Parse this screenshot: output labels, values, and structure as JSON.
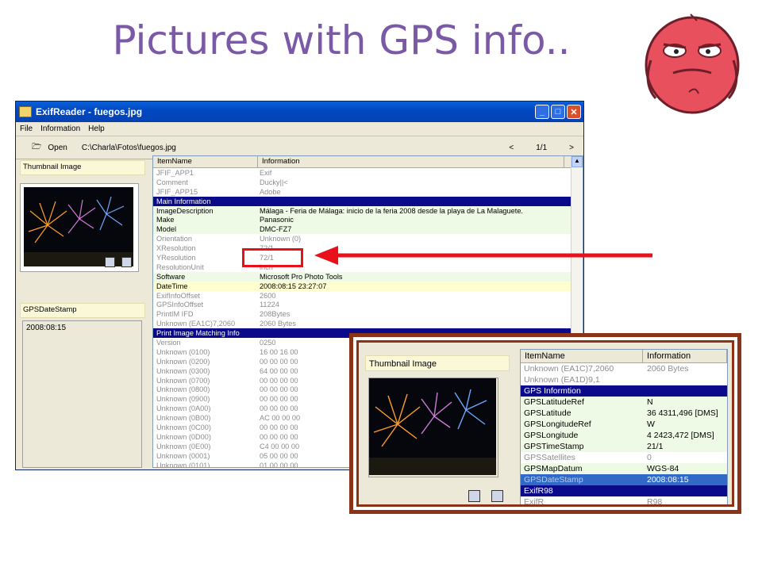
{
  "slide": {
    "title": "Pictures with GPS info.."
  },
  "window": {
    "title": "ExifReader - fuegos.jpg",
    "menu": [
      "File",
      "Information",
      "Help"
    ],
    "open_label": "Open",
    "path": "C:\\Charla\\Fotos\\fuegos.jpg",
    "pager": {
      "prev": "<",
      "page": "1/1",
      "next": ">"
    },
    "thumbnail_header": "Thumbnail Image",
    "gps_header": "GPSDateStamp",
    "gps_value": "2008:08:15",
    "columns": [
      "ItemName",
      "Information"
    ],
    "rows": [
      {
        "name": "JFIF_APP1",
        "value": "Exif",
        "style": "gray"
      },
      {
        "name": "Comment",
        "value": "Ducky||<",
        "style": "gray"
      },
      {
        "name": "JFIF_APP15",
        "value": "Adobe",
        "style": "gray"
      },
      {
        "name": "Main Information",
        "value": "",
        "style": "section"
      },
      {
        "name": "ImageDescription",
        "value": "Málaga - Feria de Málaga: inicio de la feria 2008 desde la playa de La Malaguete.",
        "style": "green"
      },
      {
        "name": "Make",
        "value": "Panasonic",
        "style": "green"
      },
      {
        "name": "Model",
        "value": "DMC-FZ7",
        "style": "green"
      },
      {
        "name": "Orientation",
        "value": "Unknown (0)",
        "style": "gray"
      },
      {
        "name": "XResolution",
        "value": "72/1",
        "style": "gray"
      },
      {
        "name": "YResolution",
        "value": "72/1",
        "style": "gray"
      },
      {
        "name": "ResolutionUnit",
        "value": "inch",
        "style": "gray"
      },
      {
        "name": "Software",
        "value": "Microsoft Pro Photo Tools",
        "style": "green"
      },
      {
        "name": "DateTime",
        "value": "2008:08:15 23:27:07",
        "style": "yellow"
      },
      {
        "name": "ExifInfoOffset",
        "value": "2600",
        "style": "gray"
      },
      {
        "name": "GPSInfoOffset",
        "value": "11224",
        "style": "gray"
      },
      {
        "name": "PrintIM IFD",
        "value": "208Bytes",
        "style": "gray"
      },
      {
        "name": "Unknown (EA1C)7,2060",
        "value": "2060 Bytes",
        "style": "gray"
      },
      {
        "name": "Print Image Matching Info",
        "value": "",
        "style": "section"
      },
      {
        "name": "Version",
        "value": "0250",
        "style": "gray"
      },
      {
        "name": "Unknown (0100)",
        "value": "16 00 16 00",
        "style": "gray"
      },
      {
        "name": "Unknown (0200)",
        "value": "00 00 00 00",
        "style": "gray"
      },
      {
        "name": "Unknown (0300)",
        "value": "64 00 00 00",
        "style": "gray"
      },
      {
        "name": "Unknown (0700)",
        "value": "00 00 00 00",
        "style": "gray"
      },
      {
        "name": "Unknown (0800)",
        "value": "00 00 00 00",
        "style": "gray"
      },
      {
        "name": "Unknown (0900)",
        "value": "00 00 00 00",
        "style": "gray"
      },
      {
        "name": "Unknown (0A00)",
        "value": "00 00 00 00",
        "style": "gray"
      },
      {
        "name": "Unknown (0B00)",
        "value": "AC 00 00 00",
        "style": "gray"
      },
      {
        "name": "Unknown (0C00)",
        "value": "00 00 00 00",
        "style": "gray"
      },
      {
        "name": "Unknown (0D00)",
        "value": "00 00 00 00",
        "style": "gray"
      },
      {
        "name": "Unknown (0E00)",
        "value": "C4 00 00 00",
        "style": "gray"
      },
      {
        "name": "Unknown (0001)",
        "value": "05 00 00 00",
        "style": "gray"
      },
      {
        "name": "Unknown (0101)",
        "value": "01 00 00 00",
        "style": "gray"
      }
    ]
  },
  "inset": {
    "thumbnail_header": "Thumbnail Image",
    "columns": [
      "ItemName",
      "Information"
    ],
    "rows": [
      {
        "name": "Unknown (EA1C)7,2060",
        "value": "2060 Bytes",
        "style": "gray"
      },
      {
        "name": "Unknown (EA1D)9,1",
        "value": "",
        "style": "gray"
      },
      {
        "name": "GPS Informtion",
        "value": "",
        "style": "section"
      },
      {
        "name": "GPSLatitudeRef",
        "value": "N",
        "style": "green"
      },
      {
        "name": "GPSLatitude",
        "value": "36 4311,496 [DMS]",
        "style": "green"
      },
      {
        "name": "GPSLongitudeRef",
        "value": "W",
        "style": "green"
      },
      {
        "name": "GPSLongitude",
        "value": "4 2423,472 [DMS]",
        "style": "green"
      },
      {
        "name": "GPSTimeStamp",
        "value": "21/1",
        "style": "green"
      },
      {
        "name": "GPSSatellites",
        "value": "0",
        "style": "gray"
      },
      {
        "name": "GPSMapDatum",
        "value": "WGS-84",
        "style": "green"
      },
      {
        "name": "GPSDateStamp",
        "value": "2008:08:15",
        "style": "selected"
      },
      {
        "name": "ExifR98",
        "value": "",
        "style": "section"
      },
      {
        "name": "ExifR",
        "value": "R98",
        "style": "gray"
      }
    ]
  },
  "colors": {
    "title": "#7a5aa6",
    "arrow": "#e8101a",
    "frame": "#8b3318",
    "section": "#0a0a8a"
  }
}
